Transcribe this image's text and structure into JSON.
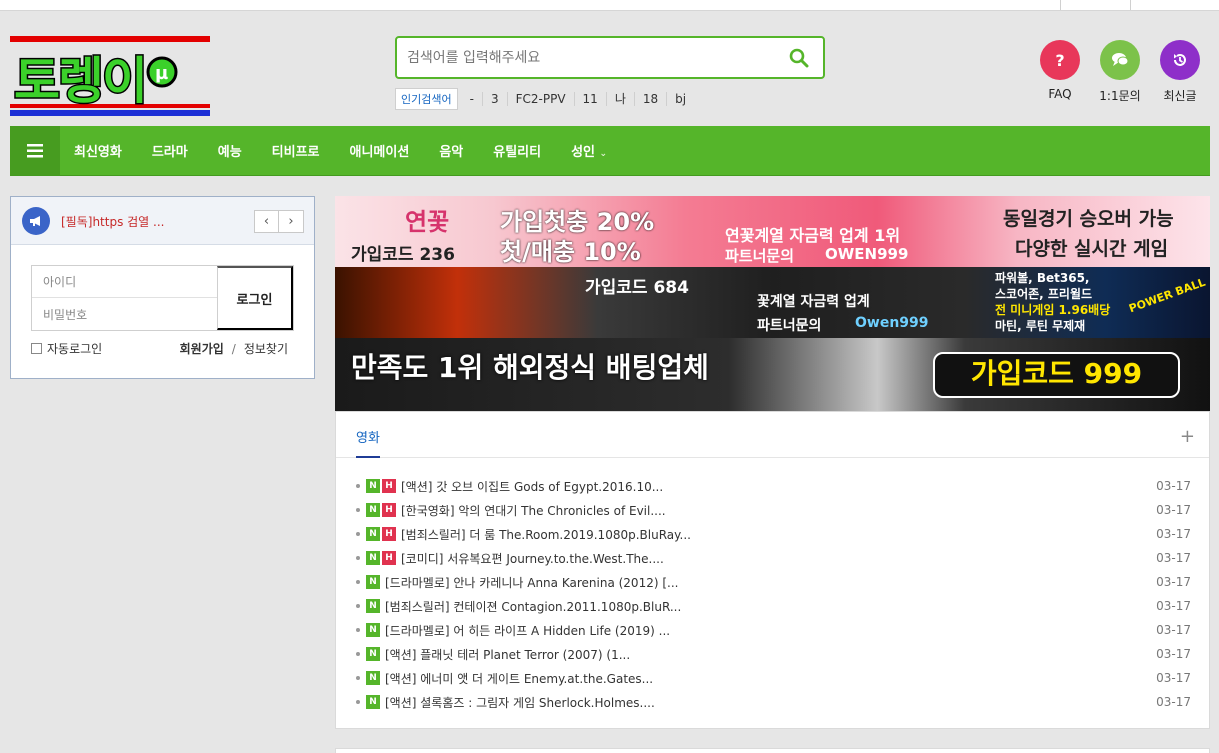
{
  "logo": {
    "text": "토렝이",
    "colors": {
      "green": "#3bd12a",
      "red": "#e30000",
      "blue": "#1c2fd6"
    }
  },
  "search": {
    "placeholder": "검색어를 입력해주세요"
  },
  "popular": {
    "label": "인기검색어",
    "keywords": [
      "-",
      "3",
      "FC2-PPV",
      "11",
      "나",
      "18",
      "bj"
    ]
  },
  "quick": [
    {
      "label": "FAQ",
      "icon": "question-icon",
      "color": "#e8375a"
    },
    {
      "label": "1:1문의",
      "icon": "chat-icon",
      "color": "#7cc24a"
    },
    {
      "label": "최신글",
      "icon": "history-icon",
      "color": "#8e2fc9"
    }
  ],
  "nav": {
    "items": [
      "최신영화",
      "드라마",
      "예능",
      "티비프로",
      "애니메이션",
      "음악",
      "유틸리티",
      "성인"
    ],
    "accent": "#55b52a"
  },
  "notice": {
    "text": "[필독]https 검열 ...",
    "prev": "‹",
    "next": "›"
  },
  "login": {
    "id_placeholder": "아이디",
    "pw_placeholder": "비밀번호",
    "button": "로그인",
    "auto": "자동로그인",
    "join": "회원가입",
    "find": "정보찾기",
    "slash": "/"
  },
  "banners": {
    "b1": {
      "left": "연꽃",
      "code": "가입코드 236",
      "mid1": "가입첫충 20%",
      "mid2": "첫/매충 10%",
      "center1": "연꽃계열 자금력 업계 1위",
      "center2": "파트너문의",
      "handle": "OWEN999",
      "right1": "동일경기 승오버 가능",
      "right2": "다양한 실시간 게임"
    },
    "b2": {
      "code": "가입코드 684",
      "c1": "꽃계열 자금력 업계",
      "c2": "파트너문의",
      "handle": "Owen999",
      "r1": "파워볼, Bet365,",
      "r2": "스코어존, 프리윌드",
      "r3": "전 미니게임 1.96배당",
      "r4": "마틴, 루틴 무제재",
      "ball": "POWER BALL"
    },
    "b3": {
      "left": "만족도 1위 해외정식 배팅업체",
      "code": "가입코드 999"
    }
  },
  "panel": {
    "tab": "영화",
    "plus": "+",
    "rows": [
      {
        "n": "N",
        "h": "H",
        "title": "[액션] 갓 오브 이집트 Gods of Egypt.2016.10...",
        "date": "03-17"
      },
      {
        "n": "N",
        "h": "H",
        "title": "[한국영화] 악의 연대기 The Chronicles of Evil....",
        "date": "03-17"
      },
      {
        "n": "N",
        "h": "H",
        "title": "[범죄스릴러] 더 룸 The.Room.2019.1080p.BluRay...",
        "date": "03-17"
      },
      {
        "n": "N",
        "h": "H",
        "title": "[코미디] 서유복요편 Journey.to.the.West.The....",
        "date": "03-17"
      },
      {
        "n": "N",
        "h": "",
        "title": "[드라마멜로] 안나 카레니나 Anna Karenina (2012) [...",
        "date": "03-17"
      },
      {
        "n": "N",
        "h": "",
        "title": "[범죄스릴러] 컨테이젼 Contagion.2011.1080p.BluR...",
        "date": "03-17"
      },
      {
        "n": "N",
        "h": "",
        "title": "[드라마멜로] 어 히든 라이프 A Hidden Life (2019) ...",
        "date": "03-17"
      },
      {
        "n": "N",
        "h": "",
        "title": "[액션] 플래닛 테러 Planet Terror (2007) (1...",
        "date": "03-17"
      },
      {
        "n": "N",
        "h": "",
        "title": "[액션] 에너미 앳 더 게이트 Enemy.at.the.Gates...",
        "date": "03-17"
      },
      {
        "n": "N",
        "h": "",
        "title": "[액션] 셜록홈즈 : 그림자 게임 Sherlock.Holmes....",
        "date": "03-17"
      }
    ]
  }
}
